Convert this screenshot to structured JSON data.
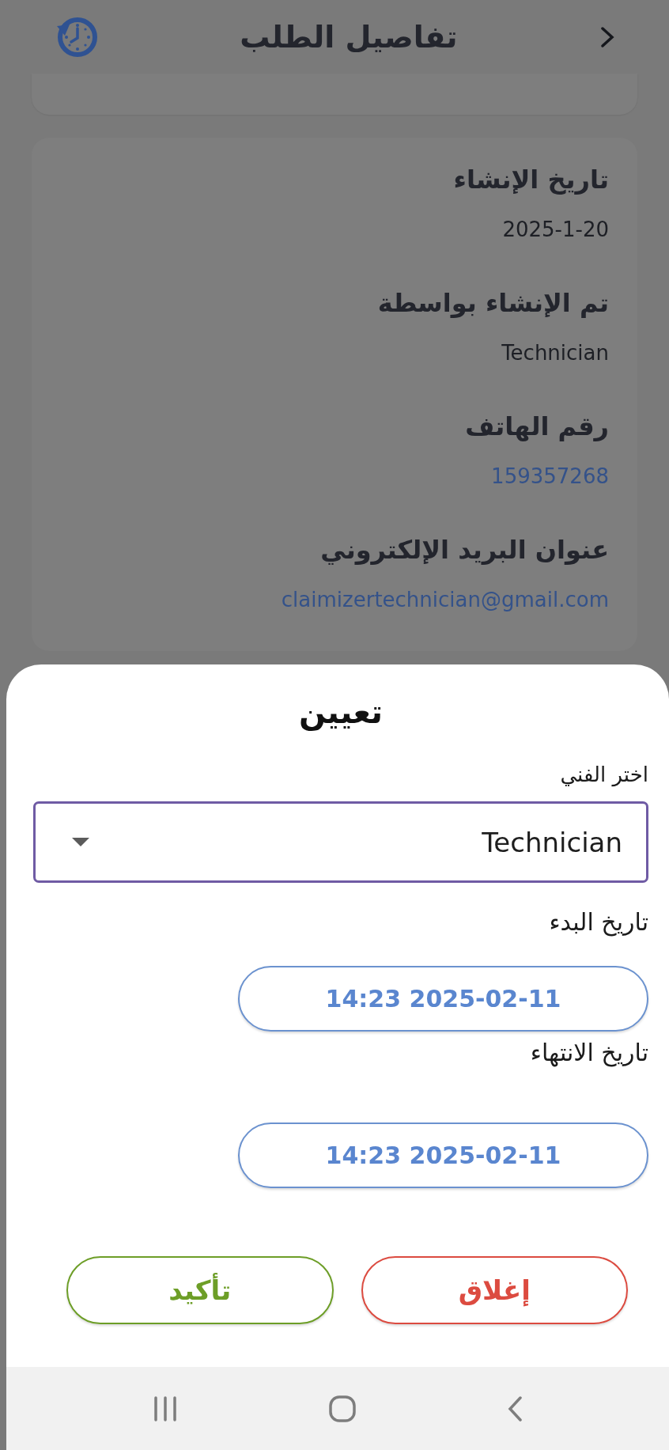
{
  "header": {
    "title": "تفاصيل الطلب"
  },
  "details": [
    {
      "label": "تاريخ الإنشاء",
      "value": "2025-1-20",
      "kind": "text"
    },
    {
      "label": "تم الإنشاء بواسطة",
      "value": "Technician",
      "kind": "text"
    },
    {
      "label": "رقم الهاتف",
      "value": "159357268",
      "kind": "link"
    },
    {
      "label": "عنوان البريد الإلكتروني",
      "value": "claimizertechnician@gmail.com",
      "kind": "link"
    }
  ],
  "sheet": {
    "title": "تعيين",
    "technician_label": "اختر الفني",
    "technician": {
      "value": "Technician"
    },
    "start_label": "تاريخ البدء",
    "start": "14:23 2025-02-11",
    "end_label": "تاريخ الانتهاء",
    "end": "14:23 2025-02-11",
    "buttons": [
      {
        "label": "إغلاق",
        "kind": "close"
      },
      {
        "label": "تأكيد",
        "kind": "confirm"
      }
    ]
  }
}
